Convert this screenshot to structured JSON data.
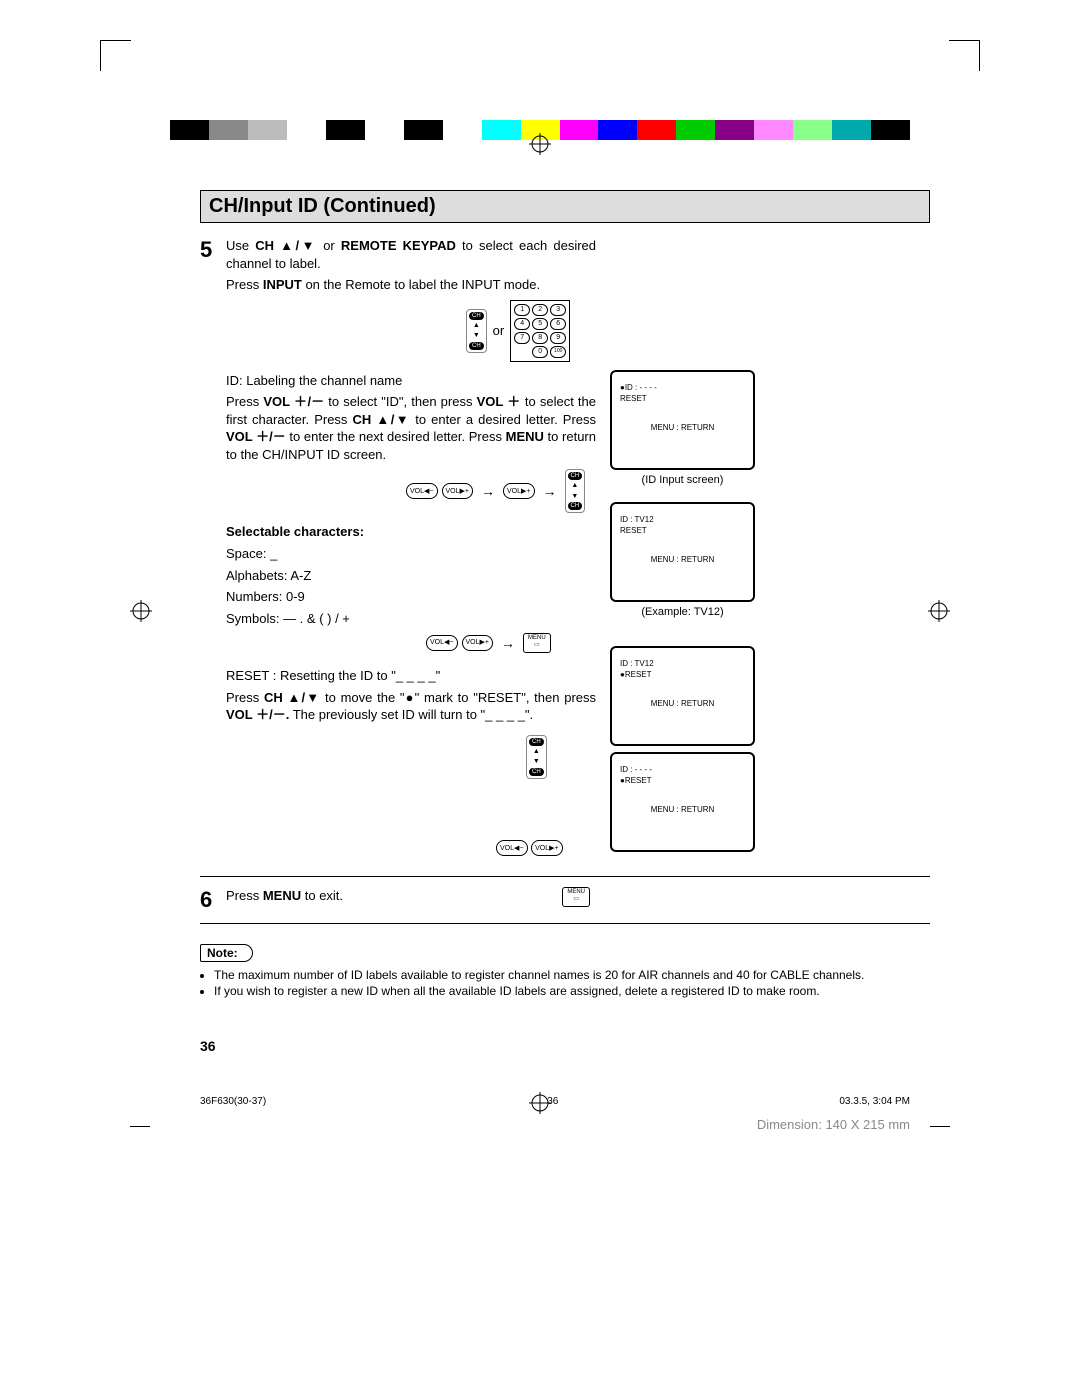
{
  "header_title": "CH/Input ID (Continued)",
  "step5": {
    "num": "5",
    "line1a": "Use ",
    "line1b": "CH ▲/▼",
    "line1c": " or ",
    "line1d": "REMOTE KEYPAD",
    "line1e": " to select each desired channel to label.",
    "line2a": "Press ",
    "line2b": "INPUT",
    "line2c": " on the Remote to label the INPUT mode.",
    "or_label": "or",
    "id_labeling": "ID: Labeling the channel name",
    "para2a": "Press ",
    "para2b": "VOL ＋/－",
    "para2c": " to select \"ID\", then press ",
    "para2d": "VOL ＋",
    "para2e": " to select the first character. Press ",
    "para2f": "CH ▲/▼",
    "para2g": " to enter a desired letter. Press ",
    "para2h": "VOL ＋/－",
    "para2i": " to enter the next desired letter. Press ",
    "para2j": "MENU",
    "para2k": " to return to the CH/INPUT ID screen.",
    "selectable_heading": "Selectable characters:",
    "space_line": "Space: _",
    "alpha_line": "Alphabets: A-Z",
    "num_line": "Numbers: 0-9",
    "sym_line": "Symbols: —  .  &  (  )  /  +",
    "reset_heading": "RESET : Resetting the ID to \"_ _ _ _\"",
    "reset_a": "Press ",
    "reset_b": "CH ▲/▼",
    "reset_c": " to move the \"●\" mark to \"RESET\", then press ",
    "reset_d": "VOL ＋/－.",
    "reset_e": " The previously set ID will turn to \"_ _ _ _\"."
  },
  "step6": {
    "num": "6",
    "text_a": "Press ",
    "text_b": "MENU",
    "text_c": " to exit."
  },
  "note_label": "Note:",
  "notes": [
    "The maximum number of ID labels available to register channel names is 20 for AIR channels and 40 for CABLE channels.",
    "If you wish to register a new ID when all the available ID labels are assigned, delete a registered ID to make room."
  ],
  "osd": {
    "s1_line1": "●ID     : - - - -",
    "s1_line2": "  RESET",
    "s1_line3": "MENU : RETURN",
    "label1": "(ID Input screen)",
    "s2_line1": "  ID     : TV12",
    "s2_line2": "  RESET",
    "s2_line3": "MENU : RETURN",
    "label2": "(Example: TV12)",
    "s3_line1": "  ID     : TV12",
    "s3_line2": "●RESET",
    "s3_line3": "MENU : RETURN",
    "s4_line1": "  ID     : - - - -",
    "s4_line2": "●RESET",
    "s4_line3": "MENU : RETURN"
  },
  "buttons": {
    "ch": "CH",
    "vol_minus": "VOL −",
    "vol_plus": "VOL +",
    "menu": "MENU"
  },
  "keypad": [
    "1",
    "2",
    "3",
    "4",
    "5",
    "6",
    "7",
    "8",
    "9",
    "0",
    "100"
  ],
  "page_number": "36",
  "footer": {
    "left": "36F630(30-37)",
    "mid": "36",
    "right": "03.3.5, 3:04 PM"
  },
  "dimension": "Dimension: 140  X  215 mm",
  "colorbar": [
    "#000",
    "#888",
    "#bbb",
    "#fff",
    "#000",
    "#fff",
    "#000",
    "#fff",
    "#0ff",
    "#ff0",
    "#f0f",
    "#00f",
    "#f00",
    "#0c0",
    "#808",
    "#f8f",
    "#8f8",
    "#0aa",
    "#000"
  ]
}
